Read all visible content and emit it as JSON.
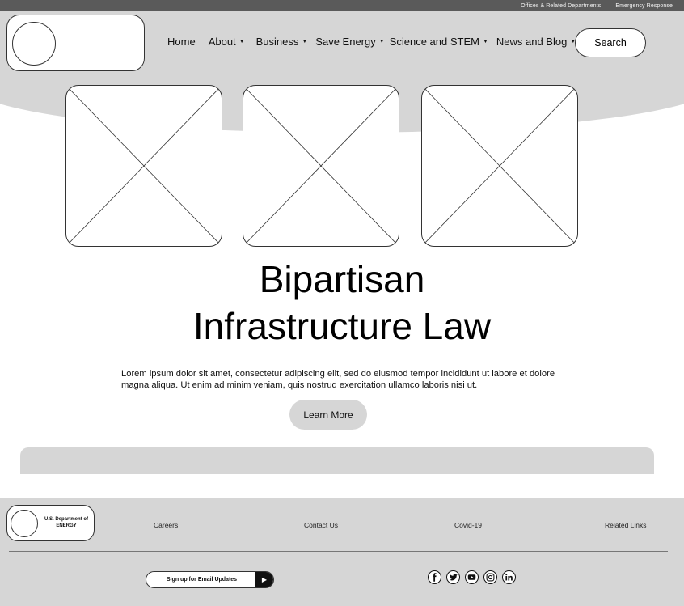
{
  "utility": {
    "offices_label": "Offices & Related Departments",
    "emergency_label": "Emergency Response"
  },
  "nav": {
    "home": "Home",
    "about": "About",
    "business": "Business",
    "save_energy": "Save Energy",
    "science_stem": "Science and STEM",
    "news_blog": "News and Blog",
    "caret": "▼"
  },
  "search": {
    "label": "Search"
  },
  "hero": {
    "title_line1": "Bipartisan",
    "title_line2": "Infrastructure Law",
    "body": "Lorem ipsum dolor sit amet, consectetur adipiscing elit, sed do eiusmod tempor incididunt ut labore et dolore magna aliqua. Ut enim ad minim veniam, quis nostrud exercitation ullamco laboris nisi ut.",
    "cta_label": "Learn More"
  },
  "footer": {
    "logo_text": "U.S. Department of ENERGY",
    "links": {
      "careers": "Careers",
      "contact": "Contact Us",
      "covid": "Covid-19",
      "related": "Related Links"
    },
    "email_signup_label": "Sign up for Email Updates",
    "social": [
      "facebook-icon",
      "twitter-icon",
      "youtube-icon",
      "instagram-icon",
      "linkedin-icon"
    ]
  },
  "colors": {
    "utility_bar": "#5a5a5a",
    "header_band": "#d6d6d6",
    "footer": "#d6d6d6"
  }
}
